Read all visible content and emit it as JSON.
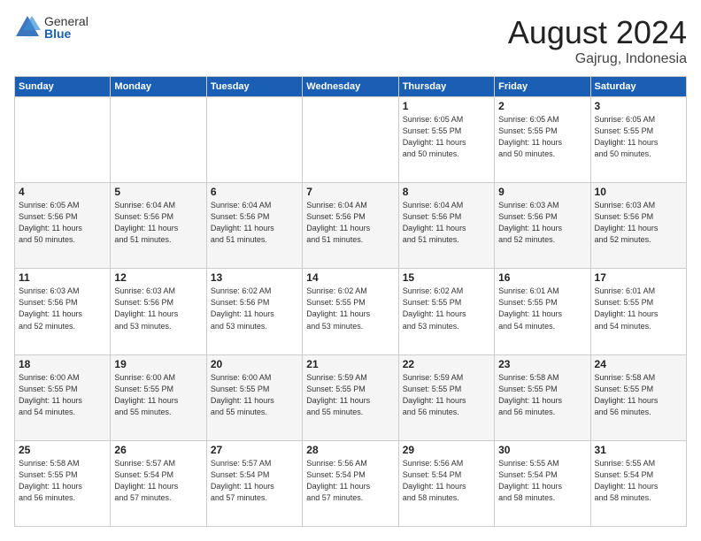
{
  "logo": {
    "general": "General",
    "blue": "Blue"
  },
  "title": "August 2024",
  "subtitle": "Gajrug, Indonesia",
  "days_of_week": [
    "Sunday",
    "Monday",
    "Tuesday",
    "Wednesday",
    "Thursday",
    "Friday",
    "Saturday"
  ],
  "weeks": [
    [
      {
        "day": "",
        "info": ""
      },
      {
        "day": "",
        "info": ""
      },
      {
        "day": "",
        "info": ""
      },
      {
        "day": "",
        "info": ""
      },
      {
        "day": "1",
        "info": "Sunrise: 6:05 AM\nSunset: 5:55 PM\nDaylight: 11 hours\nand 50 minutes."
      },
      {
        "day": "2",
        "info": "Sunrise: 6:05 AM\nSunset: 5:55 PM\nDaylight: 11 hours\nand 50 minutes."
      },
      {
        "day": "3",
        "info": "Sunrise: 6:05 AM\nSunset: 5:55 PM\nDaylight: 11 hours\nand 50 minutes."
      }
    ],
    [
      {
        "day": "4",
        "info": "Sunrise: 6:05 AM\nSunset: 5:56 PM\nDaylight: 11 hours\nand 50 minutes."
      },
      {
        "day": "5",
        "info": "Sunrise: 6:04 AM\nSunset: 5:56 PM\nDaylight: 11 hours\nand 51 minutes."
      },
      {
        "day": "6",
        "info": "Sunrise: 6:04 AM\nSunset: 5:56 PM\nDaylight: 11 hours\nand 51 minutes."
      },
      {
        "day": "7",
        "info": "Sunrise: 6:04 AM\nSunset: 5:56 PM\nDaylight: 11 hours\nand 51 minutes."
      },
      {
        "day": "8",
        "info": "Sunrise: 6:04 AM\nSunset: 5:56 PM\nDaylight: 11 hours\nand 51 minutes."
      },
      {
        "day": "9",
        "info": "Sunrise: 6:03 AM\nSunset: 5:56 PM\nDaylight: 11 hours\nand 52 minutes."
      },
      {
        "day": "10",
        "info": "Sunrise: 6:03 AM\nSunset: 5:56 PM\nDaylight: 11 hours\nand 52 minutes."
      }
    ],
    [
      {
        "day": "11",
        "info": "Sunrise: 6:03 AM\nSunset: 5:56 PM\nDaylight: 11 hours\nand 52 minutes."
      },
      {
        "day": "12",
        "info": "Sunrise: 6:03 AM\nSunset: 5:56 PM\nDaylight: 11 hours\nand 53 minutes."
      },
      {
        "day": "13",
        "info": "Sunrise: 6:02 AM\nSunset: 5:56 PM\nDaylight: 11 hours\nand 53 minutes."
      },
      {
        "day": "14",
        "info": "Sunrise: 6:02 AM\nSunset: 5:55 PM\nDaylight: 11 hours\nand 53 minutes."
      },
      {
        "day": "15",
        "info": "Sunrise: 6:02 AM\nSunset: 5:55 PM\nDaylight: 11 hours\nand 53 minutes."
      },
      {
        "day": "16",
        "info": "Sunrise: 6:01 AM\nSunset: 5:55 PM\nDaylight: 11 hours\nand 54 minutes."
      },
      {
        "day": "17",
        "info": "Sunrise: 6:01 AM\nSunset: 5:55 PM\nDaylight: 11 hours\nand 54 minutes."
      }
    ],
    [
      {
        "day": "18",
        "info": "Sunrise: 6:00 AM\nSunset: 5:55 PM\nDaylight: 11 hours\nand 54 minutes."
      },
      {
        "day": "19",
        "info": "Sunrise: 6:00 AM\nSunset: 5:55 PM\nDaylight: 11 hours\nand 55 minutes."
      },
      {
        "day": "20",
        "info": "Sunrise: 6:00 AM\nSunset: 5:55 PM\nDaylight: 11 hours\nand 55 minutes."
      },
      {
        "day": "21",
        "info": "Sunrise: 5:59 AM\nSunset: 5:55 PM\nDaylight: 11 hours\nand 55 minutes."
      },
      {
        "day": "22",
        "info": "Sunrise: 5:59 AM\nSunset: 5:55 PM\nDaylight: 11 hours\nand 56 minutes."
      },
      {
        "day": "23",
        "info": "Sunrise: 5:58 AM\nSunset: 5:55 PM\nDaylight: 11 hours\nand 56 minutes."
      },
      {
        "day": "24",
        "info": "Sunrise: 5:58 AM\nSunset: 5:55 PM\nDaylight: 11 hours\nand 56 minutes."
      }
    ],
    [
      {
        "day": "25",
        "info": "Sunrise: 5:58 AM\nSunset: 5:55 PM\nDaylight: 11 hours\nand 56 minutes."
      },
      {
        "day": "26",
        "info": "Sunrise: 5:57 AM\nSunset: 5:54 PM\nDaylight: 11 hours\nand 57 minutes."
      },
      {
        "day": "27",
        "info": "Sunrise: 5:57 AM\nSunset: 5:54 PM\nDaylight: 11 hours\nand 57 minutes."
      },
      {
        "day": "28",
        "info": "Sunrise: 5:56 AM\nSunset: 5:54 PM\nDaylight: 11 hours\nand 57 minutes."
      },
      {
        "day": "29",
        "info": "Sunrise: 5:56 AM\nSunset: 5:54 PM\nDaylight: 11 hours\nand 58 minutes."
      },
      {
        "day": "30",
        "info": "Sunrise: 5:55 AM\nSunset: 5:54 PM\nDaylight: 11 hours\nand 58 minutes."
      },
      {
        "day": "31",
        "info": "Sunrise: 5:55 AM\nSunset: 5:54 PM\nDaylight: 11 hours\nand 58 minutes."
      }
    ]
  ]
}
